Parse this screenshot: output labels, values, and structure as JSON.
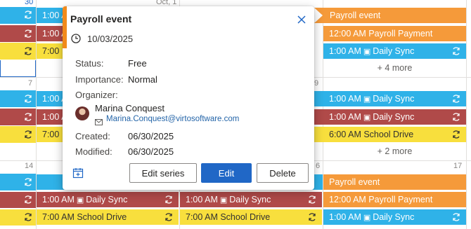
{
  "calendar": {
    "day_numbers": {
      "top_left": "30",
      "top_mid": "Oct, 1",
      "w2_left": "7",
      "w2_right": "9",
      "w3_left": "14",
      "w3_right1": "6",
      "w3_right2": "17"
    },
    "events": {
      "r1_left": {
        "time": "1:00 A"
      },
      "r2_left": {
        "time": "1:00 A"
      },
      "r3_left": {
        "time": "7:00"
      },
      "r1_right": {
        "title": "Payroll event"
      },
      "r2_right": {
        "title": "12:00 AM Payroll Payment"
      },
      "r3_right": {
        "time": "1:00 AM",
        "title": "Daily Sync"
      },
      "r4_more": "+ 4 more",
      "w2_r1_left": {
        "time": "1:00 A"
      },
      "w2_r2_left": {
        "time": "1:00 A"
      },
      "w2_r3_left": {
        "time": "7:00"
      },
      "w2_r1_right": {
        "time": "1:00 AM",
        "title": "Daily Sync"
      },
      "w2_r2_right": {
        "time": "1:00 AM",
        "title": "Daily Sync"
      },
      "w2_r3_right": {
        "title": "6:00 AM School Drive"
      },
      "w2_more": "+ 2 more",
      "w3_r1_right": {
        "title": "Payroll event"
      },
      "w3_r2_mid1": {
        "time": "1:00 AM",
        "title": "Daily Sync"
      },
      "w3_r2_mid2": {
        "time": "1:00 AM",
        "title": "Daily Sync"
      },
      "w3_r2_right": {
        "title": "12:00 AM Payroll Payment"
      },
      "w3_r3_mid1": {
        "title": "7:00 AM School Drive"
      },
      "w3_r3_mid2": {
        "title": "7:00 AM School Drive"
      },
      "w3_r3_right": {
        "time": "1:00 AM",
        "title": "Daily Sync"
      }
    }
  },
  "popup": {
    "title": "Payroll event",
    "date": "10/03/2025",
    "status_label": "Status:",
    "status_value": "Free",
    "importance_label": "Importance:",
    "importance_value": "Normal",
    "organizer_label": "Organizer:",
    "organizer_name": "Marina Conquest",
    "organizer_email": "Marina.Conquest@virtosoftware.com",
    "created_label": "Created:",
    "created_value": "06/30/2025",
    "modified_label": "Modified:",
    "modified_value": "06/30/2025",
    "buttons": {
      "edit_series": "Edit series",
      "edit": "Edit",
      "delete": "Delete"
    }
  },
  "colors": {
    "blue": "#2fb2e8",
    "red": "#b04a49",
    "yellow": "#f8df3d",
    "orange": "#f59a3a",
    "primary": "#2067c6",
    "accent": "#f18a1b"
  },
  "icons": [
    "sync-icon",
    "teams-icon",
    "clock-icon",
    "close-icon",
    "mail-icon",
    "calendar-add-icon",
    "avatar"
  ]
}
